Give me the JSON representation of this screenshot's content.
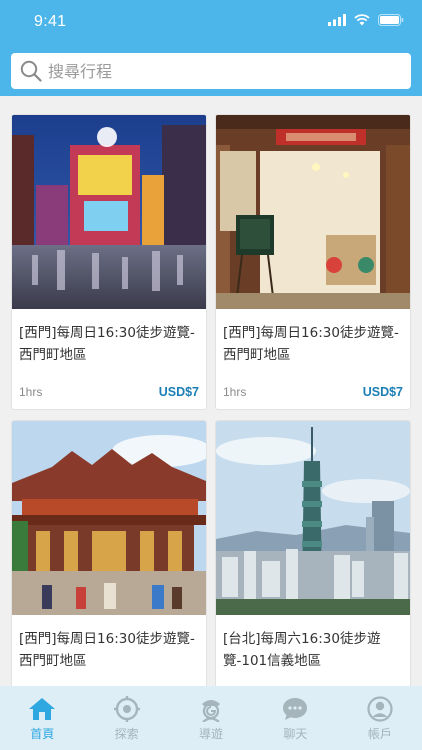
{
  "status": {
    "time": "9:41"
  },
  "search": {
    "placeholder": "搜尋行程"
  },
  "cards": [
    {
      "title": "[西門]每周日16:30徒步遊覽-西門町地區",
      "duration": "1hrs",
      "price": "USD$7",
      "image": "ximending-night-street-photo"
    },
    {
      "title": "[西門]每周日16:30徒步遊覽-西門町地區",
      "duration": "1hrs",
      "price": "USD$7",
      "image": "cafe-storefront-photo"
    },
    {
      "title": "[西門]每周日16:30徒步遊覽-西門町地區",
      "image": "temple-photo"
    },
    {
      "title": "[台北]每周六16:30徒步遊覽-101信義地區",
      "image": "taipei-101-skyline-photo"
    }
  ],
  "tabs": [
    {
      "label": "首頁",
      "icon": "home-icon",
      "active": true
    },
    {
      "label": "探索",
      "icon": "compass-icon",
      "active": false
    },
    {
      "label": "導遊",
      "icon": "guide-icon",
      "active": false
    },
    {
      "label": "聊天",
      "icon": "chat-icon",
      "active": false
    },
    {
      "label": "帳戶",
      "icon": "account-icon",
      "active": false
    }
  ],
  "colors": {
    "header": "#4cb6ea",
    "price": "#1b7fb5",
    "tab_active": "#2fa7e0",
    "tab_inactive": "#a6b4bc"
  }
}
